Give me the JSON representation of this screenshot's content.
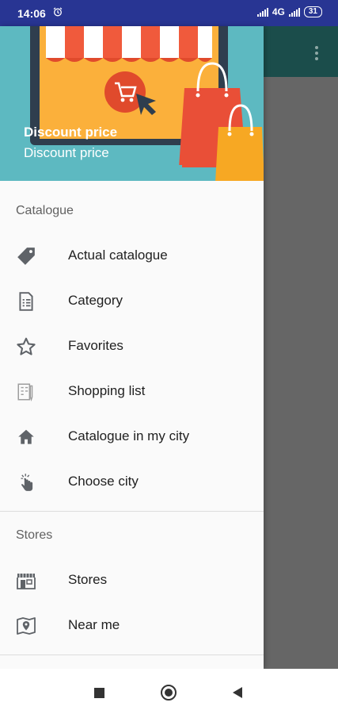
{
  "status_bar": {
    "time": "14:06",
    "network": "4G",
    "battery": "31"
  },
  "drawer": {
    "header": {
      "title": "Discount price",
      "subtitle": "Discount price"
    },
    "sections": [
      {
        "title": "Catalogue",
        "items": [
          {
            "label": "Actual catalogue",
            "icon": "price-tag-icon"
          },
          {
            "label": "Category",
            "icon": "document-list-icon"
          },
          {
            "label": "Favorites",
            "icon": "star-outline-icon"
          },
          {
            "label": "Shopping list",
            "icon": "shopping-list-icon"
          },
          {
            "label": "Catalogue in my city",
            "icon": "home-icon"
          },
          {
            "label": "Choose city",
            "icon": "tap-hand-icon"
          }
        ]
      },
      {
        "title": "Stores",
        "items": [
          {
            "label": "Stores",
            "icon": "storefront-icon"
          },
          {
            "label": "Near me",
            "icon": "map-pin-icon"
          }
        ]
      }
    ]
  },
  "colors": {
    "status_bar": "#283593",
    "header_bg": "#5db9c1",
    "app_toolbar": "#1b4d4b",
    "scrim": "#666666"
  }
}
